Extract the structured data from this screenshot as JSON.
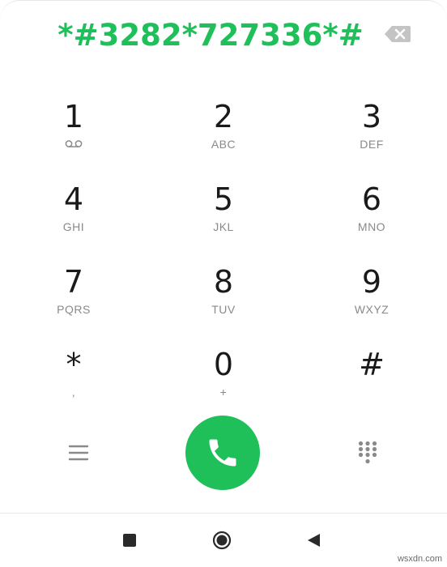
{
  "dialer": {
    "number": "*#3282*727336*#",
    "colors": {
      "accent": "#1fbf5a",
      "digit": "#1a1a1a",
      "letters": "#8a8a8a"
    }
  },
  "keys": [
    {
      "digit": "1",
      "sub": "",
      "sub_icon": "voicemail-icon"
    },
    {
      "digit": "2",
      "sub": "ABC"
    },
    {
      "digit": "3",
      "sub": "DEF"
    },
    {
      "digit": "4",
      "sub": "GHI"
    },
    {
      "digit": "5",
      "sub": "JKL"
    },
    {
      "digit": "6",
      "sub": "MNO"
    },
    {
      "digit": "7",
      "sub": "PQRS"
    },
    {
      "digit": "8",
      "sub": "TUV"
    },
    {
      "digit": "9",
      "sub": "WXYZ"
    },
    {
      "digit": "*",
      "sub": ","
    },
    {
      "digit": "0",
      "sub": "+"
    },
    {
      "digit": "#",
      "sub": ""
    }
  ],
  "actions": {
    "menu_icon": "menu-icon",
    "call_icon": "phone-icon",
    "dialpad_icon": "dialpad-icon"
  },
  "navbar": {
    "recents_icon": "square-icon",
    "home_icon": "circle-icon",
    "back_icon": "triangle-back-icon"
  },
  "watermark": "wsxdn.com"
}
